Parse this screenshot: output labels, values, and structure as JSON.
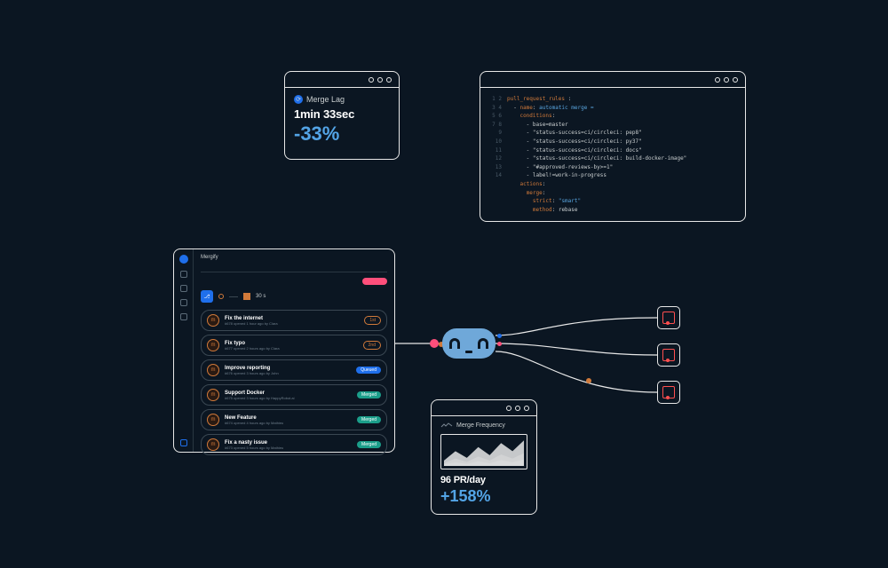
{
  "merge_lag": {
    "title": "Merge Lag",
    "value": "1min 33sec",
    "delta": "-33%"
  },
  "merge_freq": {
    "title": "Merge Frequency",
    "value": "96 PR/day",
    "delta": "+158%"
  },
  "code": {
    "lines": [
      {
        "n": "1",
        "indent": 0,
        "key": "pull_request_rules",
        "after": " :"
      },
      {
        "n": "2",
        "indent": 1,
        "pre": "- ",
        "key": "name",
        "after": ": ",
        "str": "automatic merge ="
      },
      {
        "n": "3",
        "indent": 2,
        "key": "conditions",
        "after": ":"
      },
      {
        "n": "4",
        "indent": 3,
        "pre": "- ",
        "plain": "base=master"
      },
      {
        "n": "5",
        "indent": 3,
        "pre": "- ",
        "plain": "\"status-success=ci/circleci: pep8\""
      },
      {
        "n": "6",
        "indent": 3,
        "pre": "- ",
        "plain": "\"status-success=ci/circleci: py37\""
      },
      {
        "n": "7",
        "indent": 3,
        "pre": "- ",
        "plain": "\"status-success=ci/circleci: docs\""
      },
      {
        "n": "8",
        "indent": 3,
        "pre": "- ",
        "plain": "\"status-success=ci/circleci: build-docker-image\""
      },
      {
        "n": "9",
        "indent": 3,
        "pre": "- ",
        "plain": "\"#approved-reviews-by>=1\""
      },
      {
        "n": "10",
        "indent": 3,
        "pre": "- ",
        "plain": "label!=work-in-progress"
      },
      {
        "n": "11",
        "indent": 2,
        "key": "actions",
        "after": ":"
      },
      {
        "n": "12",
        "indent": 3,
        "key": "merge",
        "after": ":"
      },
      {
        "n": "13",
        "indent": 4,
        "key": "strict",
        "after": ": ",
        "str": "\"smart\""
      },
      {
        "n": "14",
        "indent": 4,
        "key": "method",
        "after": ": ",
        "plain": "rebase"
      }
    ]
  },
  "queue": {
    "brand": "Mergify",
    "status_time": "30 s",
    "items": [
      {
        "title": "Fix the internet",
        "sub": "#678 opened 1 hour ago by Clara",
        "badge": "1st",
        "badge_kind": "orange"
      },
      {
        "title": "Fix typo",
        "sub": "#677 opened 2 hours ago by Clara",
        "badge": "2nd",
        "badge_kind": "orange"
      },
      {
        "title": "Improve reporting",
        "sub": "#676 opened 3 hours ago by John",
        "badge": "Queued",
        "badge_kind": "blue"
      },
      {
        "title": "Support Docker",
        "sub": "#675 opened 3 hours ago by HappyRobot.ai",
        "badge": "Merged",
        "badge_kind": "teal"
      },
      {
        "title": "New Feature",
        "sub": "#674 opened 4 hours ago by Mathieu",
        "badge": "Merged",
        "badge_kind": "teal"
      },
      {
        "title": "Fix a nasty issue",
        "sub": "#673 opened 5 hours ago by Mathieu",
        "badge": "Merged",
        "badge_kind": "teal"
      }
    ]
  },
  "chart_data": {
    "type": "area",
    "xlabel": "",
    "ylabel": "",
    "title": "Merge Frequency",
    "note": "values estimated from sparkline silhouette, arbitrary units",
    "values": [
      20,
      55,
      30,
      70,
      40,
      85,
      55,
      95
    ]
  }
}
